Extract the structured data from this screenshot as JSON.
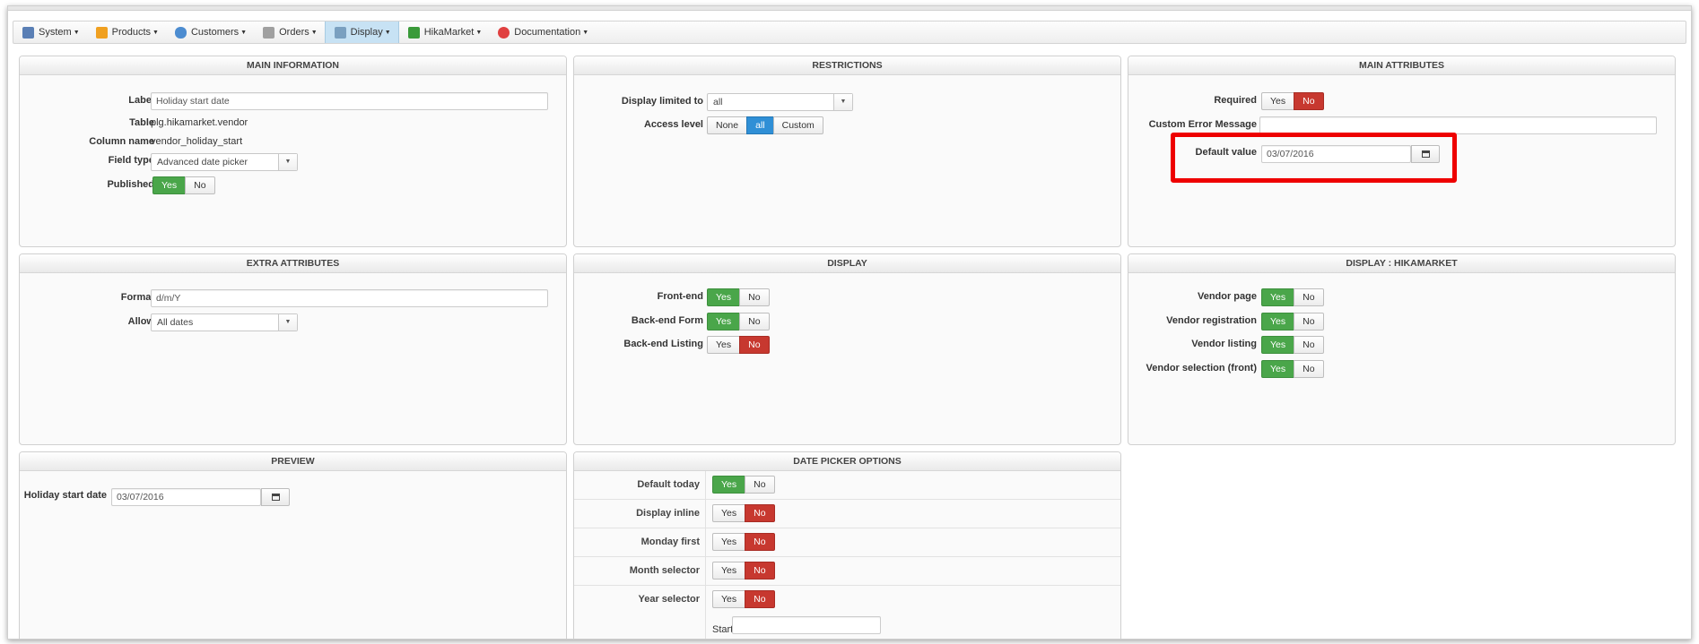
{
  "menu": [
    {
      "label": "System",
      "icon": "wrench-icon",
      "color": "#5a7fb5",
      "active": false
    },
    {
      "label": "Products",
      "icon": "box-icon",
      "color": "#f0a020",
      "active": false
    },
    {
      "label": "Customers",
      "icon": "users-icon",
      "color": "#4c8cd0",
      "active": false
    },
    {
      "label": "Orders",
      "icon": "cart-icon",
      "color": "#a0a0a0",
      "active": false
    },
    {
      "label": "Display",
      "icon": "display-icon",
      "color": "#7aa0c0",
      "active": true
    },
    {
      "label": "HikaMarket",
      "icon": "hikamarket-icon",
      "color": "#3a9a3a",
      "active": false
    },
    {
      "label": "Documentation",
      "icon": "lifebuoy-icon",
      "color": "#e04040",
      "active": false
    }
  ],
  "main_info": {
    "title": "MAIN INFORMATION",
    "label_lbl": "Label",
    "label_val": "Holiday start date",
    "table_lbl": "Table",
    "table_val": "plg.hikamarket.vendor",
    "column_lbl": "Column name",
    "column_val": "vendor_holiday_start",
    "fieldtype_lbl": "Field type",
    "fieldtype_val": "Advanced date picker",
    "published_lbl": "Published",
    "yes": "Yes",
    "no": "No"
  },
  "restrictions": {
    "title": "RESTRICTIONS",
    "display_lbl": "Display limited to",
    "display_val": "all",
    "access_lbl": "Access level",
    "access_none": "None",
    "access_all": "all",
    "access_custom": "Custom"
  },
  "main_attr": {
    "title": "MAIN ATTRIBUTES",
    "required_lbl": "Required",
    "yes": "Yes",
    "no": "No",
    "error_lbl": "Custom Error Message",
    "error_val": "",
    "default_lbl": "Default value",
    "default_val": "03/07/2016"
  },
  "extra_attr": {
    "title": "EXTRA ATTRIBUTES",
    "format_lbl": "Format",
    "format_val": "d/m/Y",
    "allow_lbl": "Allow",
    "allow_val": "All dates"
  },
  "display": {
    "title": "DISPLAY",
    "rows": [
      {
        "label": "Front-end",
        "value": "Yes"
      },
      {
        "label": "Back-end Form",
        "value": "Yes"
      },
      {
        "label": "Back-end Listing",
        "value": "No"
      }
    ],
    "yes": "Yes",
    "no": "No"
  },
  "display_hm": {
    "title": "DISPLAY : HIKAMARKET",
    "rows": [
      {
        "label": "Vendor page",
        "value": "Yes"
      },
      {
        "label": "Vendor registration",
        "value": "Yes"
      },
      {
        "label": "Vendor listing",
        "value": "Yes"
      },
      {
        "label": "Vendor selection (front)",
        "value": "Yes"
      }
    ],
    "yes": "Yes",
    "no": "No"
  },
  "preview": {
    "title": "PREVIEW",
    "lbl": "Holiday start date",
    "val": "03/07/2016"
  },
  "dp_options": {
    "title": "DATE PICKER OPTIONS",
    "rows": [
      {
        "label": "Default today",
        "value": "Yes"
      },
      {
        "label": "Display inline",
        "value": "No"
      },
      {
        "label": "Monday first",
        "value": "No"
      },
      {
        "label": "Month selector",
        "value": "No"
      },
      {
        "label": "Year selector",
        "value": "No"
      }
    ],
    "yes": "Yes",
    "no": "No",
    "start_lbl": "Start",
    "start_val": ""
  }
}
